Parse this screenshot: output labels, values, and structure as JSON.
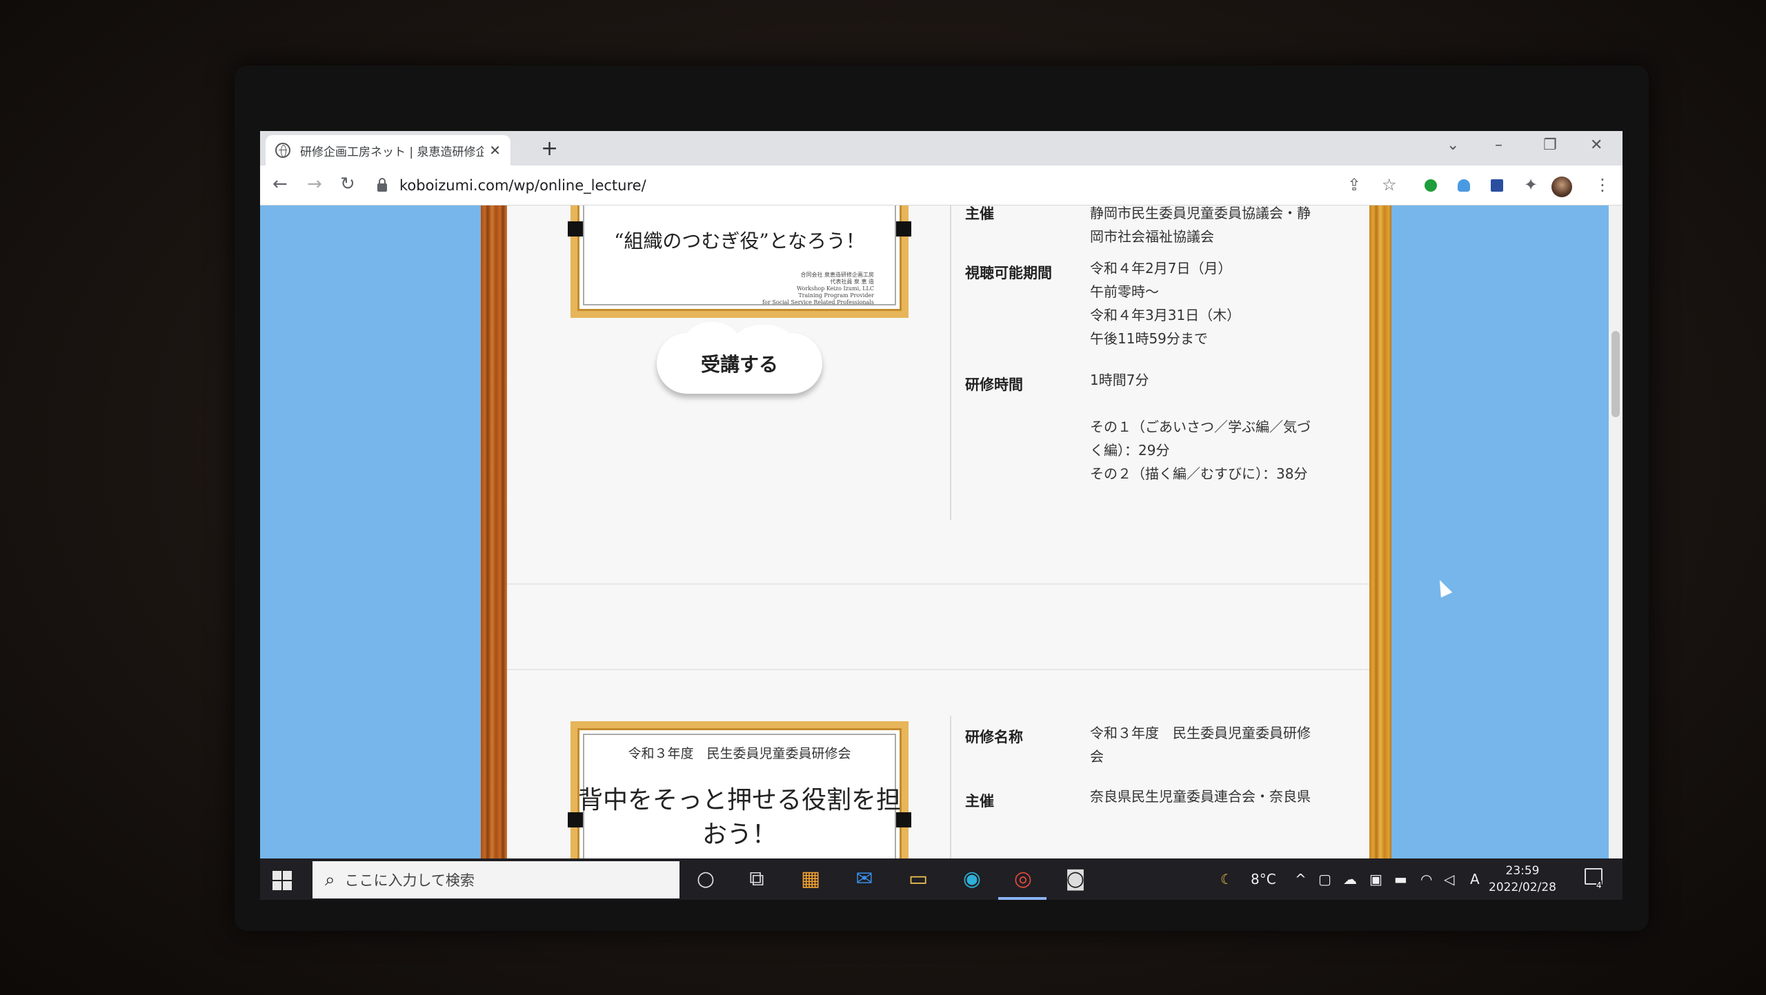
{
  "browser": {
    "tab_title": "研修企画工房ネット | 泉恵造研修企画",
    "url": "koboizumi.com/wp/online_lecture/"
  },
  "top_item": {
    "certificate_phrase": "“組織のつむぎ役”となろう！",
    "certificate_org": "合同会社 泉恵造研修企画工房\n代表社員 泉 恵 造\nWorkshop Keizo Izumi, LLC\nTraining Program Provider\nfor Social Service Related Professionals",
    "enroll_button": "受講する",
    "rows": [
      {
        "label": "主催",
        "value": "静岡市民生委員児童委員協議会・静岡市社会福祉協議会"
      },
      {
        "label": "視聴可能期間",
        "value": "令和４年2月7日（月）\n午前零時～\n令和４年3月31日（木）\n午後11時59分まで"
      },
      {
        "label": "研修時間",
        "value": "1時間7分\n\nその１（ごあいさつ／学ぶ編／気づく編）：29分\nその２（描く編／むすびに）：38分"
      }
    ]
  },
  "second_item": {
    "certificate_year": "令和３年度　民生委員児童委員研修会",
    "certificate_phrase": "背中をそっと押せる役割を担おう！",
    "rows": [
      {
        "label": "研修名称",
        "value": "令和３年度　民生委員児童委員研修会"
      },
      {
        "label": "主催",
        "value": "奈良県民生児童委員連合会・奈良県"
      }
    ]
  },
  "taskbar": {
    "search_placeholder": "ここに入力して検索",
    "weather": "8°C",
    "time": "23:59",
    "date": "2022/02/28",
    "ime": "A",
    "notification_count": "4"
  }
}
